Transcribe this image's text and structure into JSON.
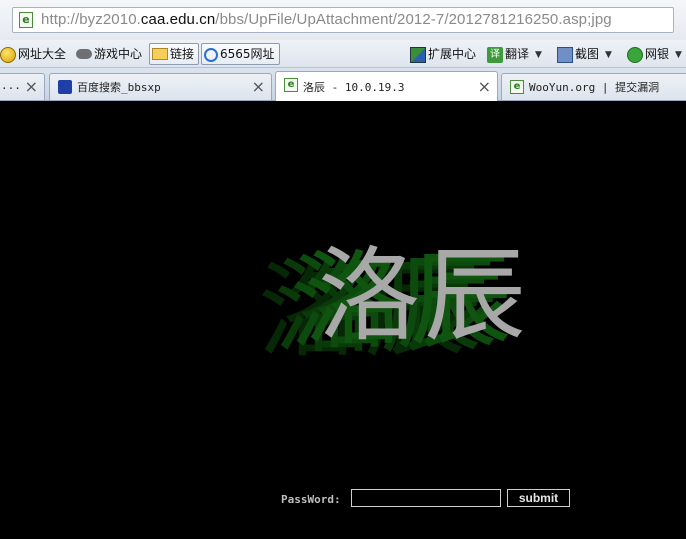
{
  "address_bar": {
    "url_prefix": "http://byz2010.",
    "url_domain": "caa.edu.cn",
    "url_path": "/bbs/UpFile/UpAttachment/2012-7/2012781216250.asp;jpg",
    "page_icon": "e"
  },
  "favorites": {
    "items": [
      {
        "label": "网址大全",
        "icon": "globe-icon"
      },
      {
        "label": "游戏中心",
        "icon": "gamepad-icon"
      },
      {
        "label": "链接",
        "icon": "folder-icon"
      },
      {
        "label": "6565网址",
        "icon": "6565-icon"
      }
    ],
    "right_items": [
      {
        "label": "扩展中心",
        "icon": "extension-icon"
      },
      {
        "label": "翻译",
        "icon": "translate-icon",
        "icon_text": "译"
      },
      {
        "label": "截图",
        "icon": "screenshot-icon"
      },
      {
        "label": "网银",
        "icon": "bank-icon"
      }
    ]
  },
  "tabs": [
    {
      "title": "...",
      "close": "×"
    },
    {
      "title": "百度搜索_bbsxp",
      "close": "×",
      "icon": "baidu-paw-icon"
    },
    {
      "title": "洛辰 - 10.0.19.3",
      "close": "×",
      "icon": "ie-page-icon",
      "active": true
    },
    {
      "title": "WooYun.org | 提交漏洞",
      "icon": "ie-page-icon"
    }
  ],
  "page": {
    "logo_text": "洛辰",
    "password_label": "PassWord:",
    "password_value": "",
    "submit_label": "submit"
  },
  "colors": {
    "background": "#000000",
    "logo_text": "#a8a8a8",
    "logo_shadow": "#0a3a0a"
  }
}
